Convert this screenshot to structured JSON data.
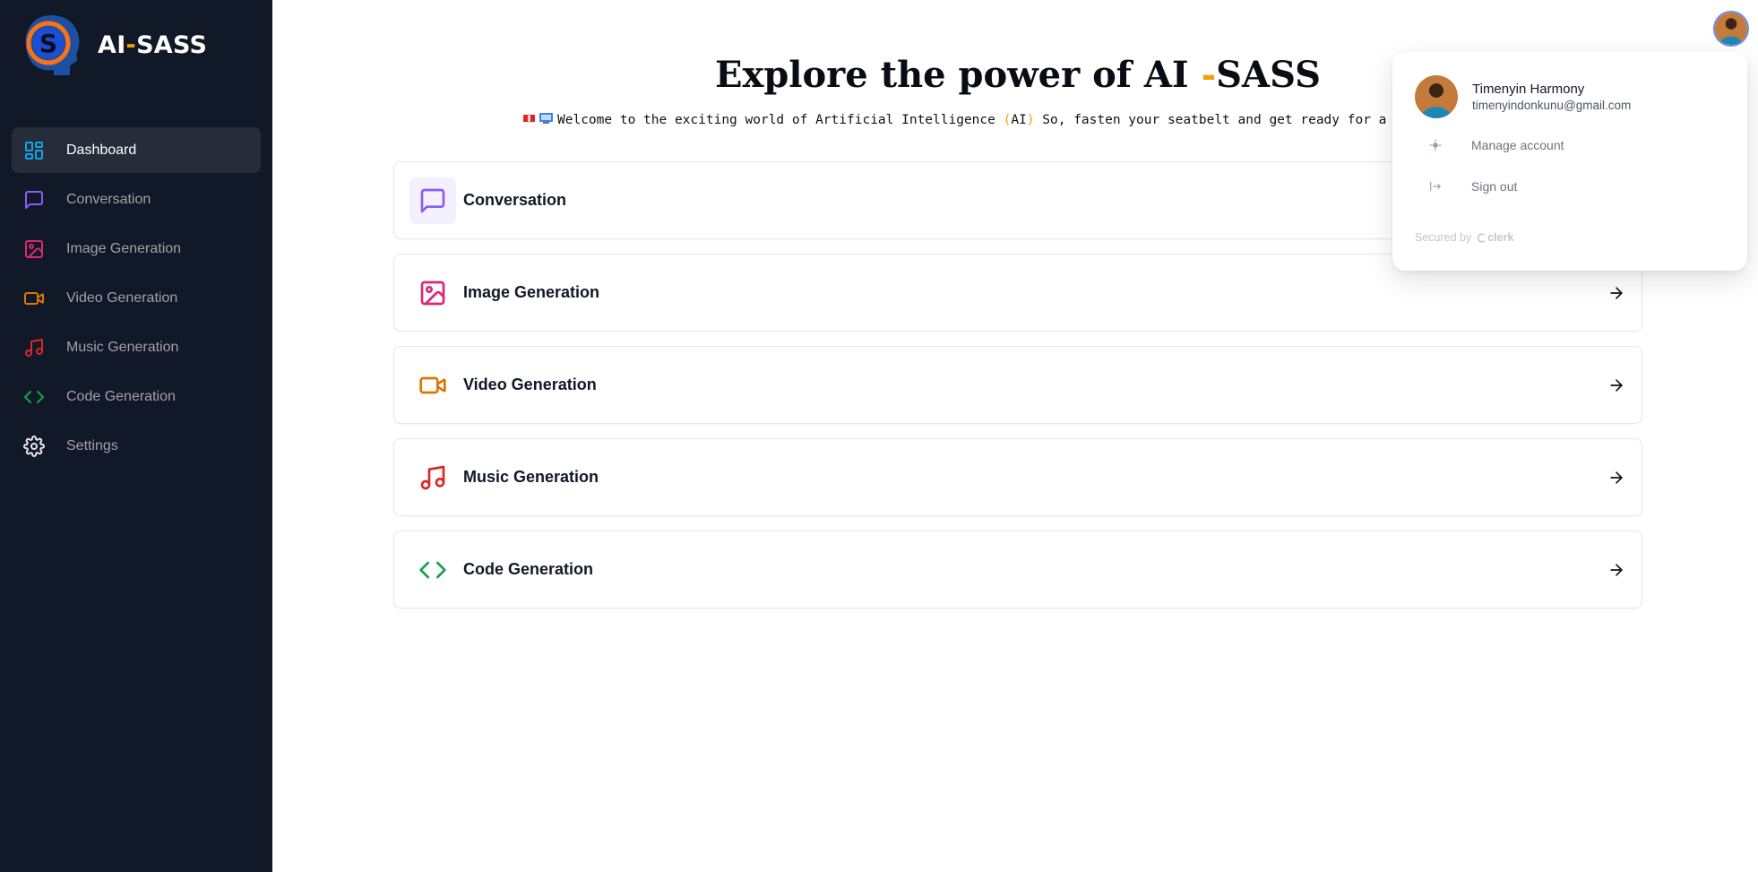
{
  "brand": {
    "name_prefix": "AI",
    "name_dash": "-",
    "name_suffix": "SASS"
  },
  "sidebar": {
    "items": [
      {
        "label": "Dashboard",
        "icon": "layout-dashboard-icon",
        "color": "#0ea5e9",
        "active": true
      },
      {
        "label": "Conversation",
        "icon": "message-square-icon",
        "color": "#8b5cf6"
      },
      {
        "label": "Image Generation",
        "icon": "image-icon",
        "color": "#db2777"
      },
      {
        "label": "Video Generation",
        "icon": "video-icon",
        "color": "#d97706"
      },
      {
        "label": "Music Generation",
        "icon": "music-icon",
        "color": "#dc2626"
      },
      {
        "label": "Code Generation",
        "icon": "code-icon",
        "color": "#16a34a"
      },
      {
        "label": "Settings",
        "icon": "settings-icon",
        "color": "#e5e7eb"
      }
    ]
  },
  "hero": {
    "title_main": "Explore the power of AI ",
    "title_dash": "-",
    "title_end": "SASS",
    "sub_before": "Welcome to the exciting world of Artificial Intelligence ",
    "sub_open": "(",
    "sub_ai": "AI",
    "sub_close": ")",
    "sub_after": " So, fasten your seatbelt and get ready for a thrilli"
  },
  "tools": [
    {
      "label": "Conversation",
      "icon": "message-square-icon",
      "color": "#8b5cf6",
      "bg": "#f3f0ff"
    },
    {
      "label": "Image Generation",
      "icon": "image-icon",
      "color": "#db2777",
      "bg": "#ffffff"
    },
    {
      "label": "Video Generation",
      "icon": "video-icon",
      "color": "#d97706",
      "bg": "#ffffff"
    },
    {
      "label": "Music Generation",
      "icon": "music-icon",
      "color": "#dc2626",
      "bg": "#ffffff"
    },
    {
      "label": "Code Generation",
      "icon": "code-icon",
      "color": "#16a34a",
      "bg": "#ffffff"
    }
  ],
  "user_menu": {
    "name": "Timenyin Harmony",
    "email": "timenyindonkunu@gmail.com",
    "manage_label": "Manage account",
    "signout_label": "Sign out",
    "secured_label": "Secured by",
    "clerk_label": "clerk"
  }
}
